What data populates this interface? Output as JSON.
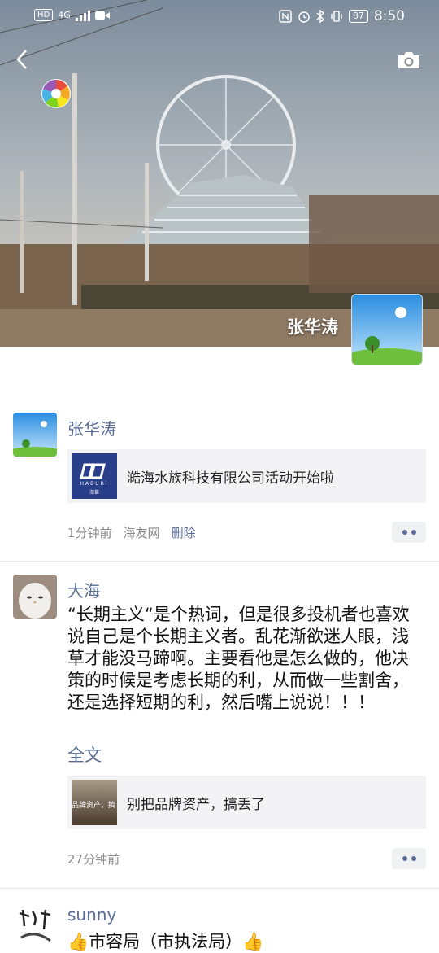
{
  "status_bar": {
    "hd": "HD",
    "network": "4G",
    "battery": "87",
    "time": "8:50"
  },
  "cover": {
    "name": "张华涛",
    "back_icon": "chevron-left-icon",
    "camera_icon": "camera-icon"
  },
  "posts": [
    {
      "author": "张华涛",
      "link": {
        "thumb_brand": "HABURI",
        "thumb_sub": "海苗",
        "title": "澔海水族科技有限公司活动开始啦"
      },
      "time": "1分钟前",
      "source": "海友网",
      "delete_label": "删除"
    },
    {
      "author": "大海",
      "text": "“长期主义“是个热词，但是很多投机者也喜欢说自己是个长期主义者。乱花渐欲迷人眼，浅草才能没马蹄啊。主要看他是怎么做的，他决策的时候是考虑长期的利，从而做一些割舍，还是选择短期的利，然后嘴上说说！！！",
      "full_text_label": "全文",
      "link": {
        "thumb_text": "品牌资产，搞",
        "title": "别把品牌资产，搞丢了"
      },
      "time": "27分钟前"
    },
    {
      "author": "sunny",
      "text": "👍市容局（市执法局）👍"
    }
  ]
}
